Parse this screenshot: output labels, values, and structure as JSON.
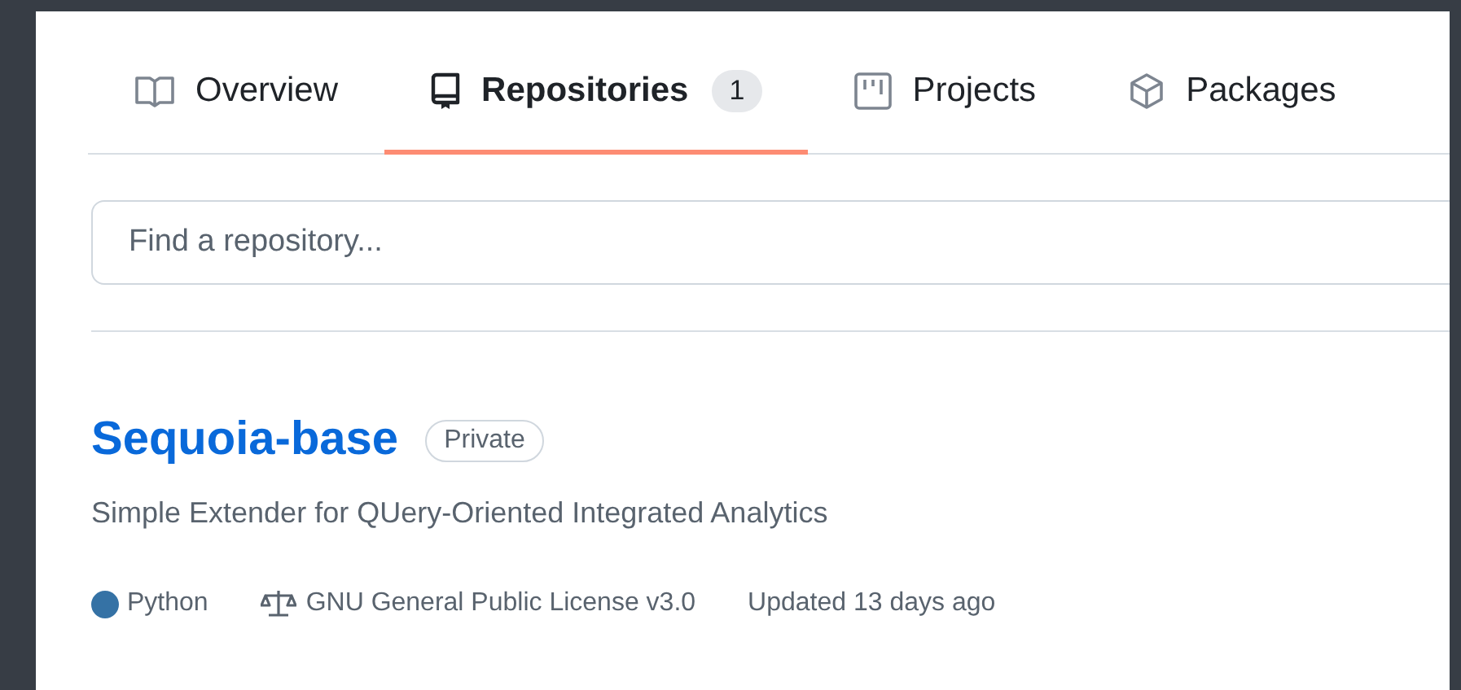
{
  "tabs": [
    {
      "label": "Overview",
      "selected": false
    },
    {
      "label": "Repositories",
      "selected": true,
      "counter": "1"
    },
    {
      "label": "Projects",
      "selected": false
    },
    {
      "label": "Packages",
      "selected": false
    }
  ],
  "search": {
    "placeholder": "Find a repository..."
  },
  "repositories": [
    {
      "name": "Sequoia-base",
      "visibility": "Private",
      "description": "Simple Extender for QUery-Oriented Integrated Analytics",
      "language": "Python",
      "color": "#3572a5",
      "license": "GNU General Public License v3.0",
      "updated": "Updated 13 days ago"
    }
  ]
}
